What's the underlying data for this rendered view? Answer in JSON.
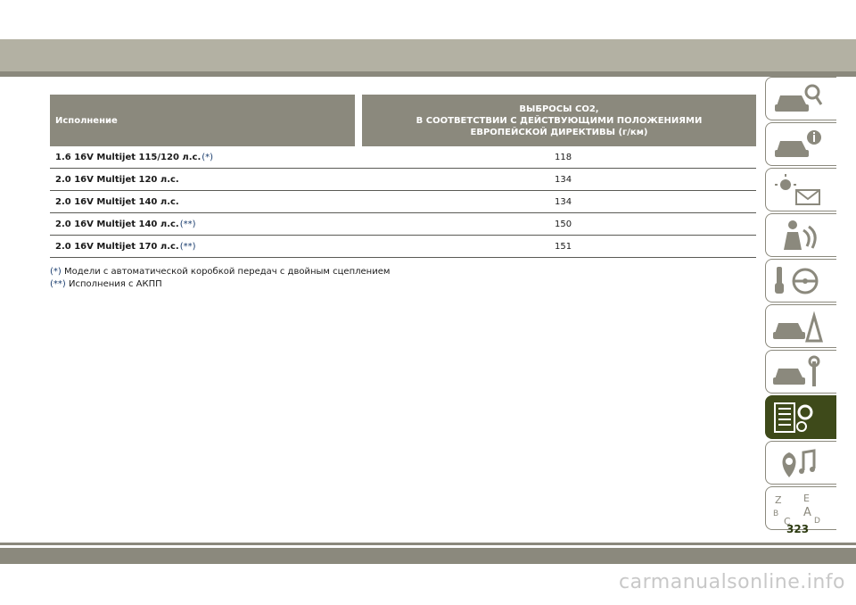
{
  "table": {
    "header_left": "Исполнение",
    "header_right": "ВЫБРОСЫ СО2,\nВ СООТВЕТСТВИИ С ДЕЙСТВУЮЩИМИ ПОЛОЖЕНИЯМИ\nЕВРОПЕЙСКОЙ ДИРЕКТИВЫ (г/км)",
    "rows": [
      {
        "engine": "1.6 16V Multijet 115/120 л.с.",
        "mark": "(*)",
        "value": "118"
      },
      {
        "engine": "2.0 16V Multijet 120 л.с.",
        "mark": "",
        "value": "134"
      },
      {
        "engine": "2.0 16V Multijet 140 л.с.",
        "mark": "",
        "value": "134"
      },
      {
        "engine": "2.0 16V Multijet 140 л.с.",
        "mark": "(**)",
        "value": "150"
      },
      {
        "engine": "2.0 16V Multijet 170 л.с.",
        "mark": "(**)",
        "value": "151"
      }
    ]
  },
  "notes": [
    {
      "mark": "(*)",
      "text": "Модели с автоматической коробкой передач с двойным сцеплением"
    },
    {
      "mark": "(**)",
      "text": "Исполнения с АКПП"
    }
  ],
  "side_tabs": [
    {
      "icon": "car-search-icon",
      "active": false
    },
    {
      "icon": "car-info-icon",
      "active": false
    },
    {
      "icon": "warning-light-message-icon",
      "active": false
    },
    {
      "icon": "seat-person-icon",
      "active": false
    },
    {
      "icon": "key-steering-icon",
      "active": false
    },
    {
      "icon": "car-breakdown-icon",
      "active": false
    },
    {
      "icon": "car-wrench-icon",
      "active": false
    },
    {
      "icon": "list-gear-icon",
      "active": true
    },
    {
      "icon": "location-music-icon",
      "active": false
    },
    {
      "icon": "alphabet-index-icon",
      "active": false
    }
  ],
  "page_number": "323",
  "watermark": "carmanualsonline.info",
  "colors": {
    "header_bg": "#8b897d",
    "top_band": "#b3b1a3",
    "active_tab": "#3e4a1a",
    "footnote_mark": "#1a3d6e"
  }
}
